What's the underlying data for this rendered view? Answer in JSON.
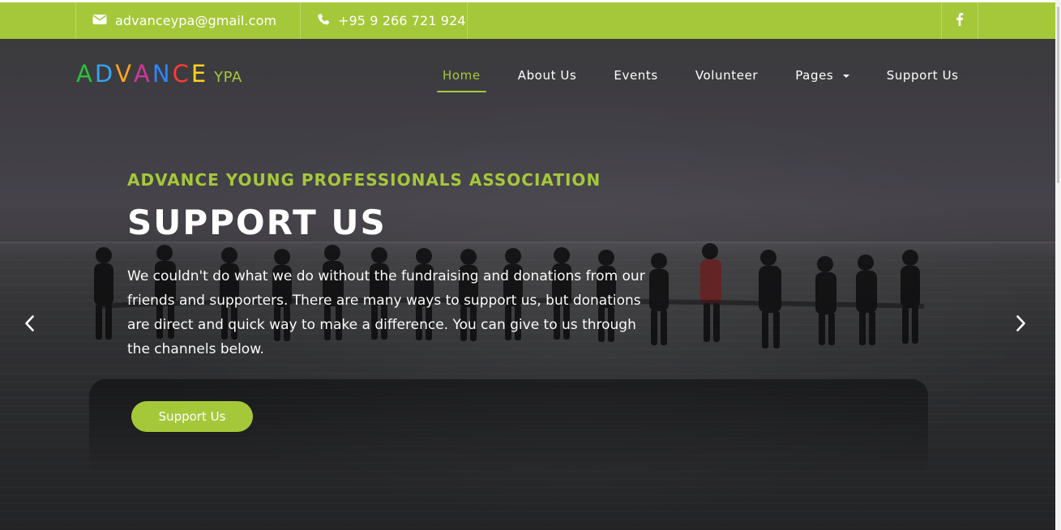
{
  "topbar": {
    "email_icon": "envelope-icon",
    "email": "advanceypa@gmail.com",
    "phone_icon": "phone-icon",
    "phone": "+95 9 266 721 924",
    "social_icon": "facebook-icon"
  },
  "brand": {
    "advance_letters": [
      {
        "char": "A",
        "color": "#2cbf3c"
      },
      {
        "char": "D",
        "color": "#35a4f0"
      },
      {
        "char": "V",
        "color": "#f7a51d"
      },
      {
        "char": "A",
        "color": "#d0389a"
      },
      {
        "char": "N",
        "color": "#2f86ff"
      },
      {
        "char": "C",
        "color": "#ff3b34"
      },
      {
        "char": "E",
        "color": "#ffd21a"
      }
    ],
    "suffix": "YPA"
  },
  "nav": {
    "items": [
      {
        "label": "Home",
        "active": true
      },
      {
        "label": "About Us",
        "active": false
      },
      {
        "label": "Events",
        "active": false
      },
      {
        "label": "Volunteer",
        "active": false
      },
      {
        "label": "Pages",
        "active": false,
        "has_caret": true
      },
      {
        "label": "Support Us",
        "active": false
      }
    ]
  },
  "hero": {
    "eyebrow": "ADVANCE YOUNG PROFESSIONALS ASSOCIATION",
    "title": "SUPPORT US",
    "description": "We couldn't do what we do without the fundraising and donations from our friends and supporters. There are many ways to support us, but donations are direct and quick way to make a difference. You can give to us through the channels below.",
    "cta_label": "Support Us",
    "prev_icon": "chevron-left-icon",
    "next_icon": "chevron-right-icon"
  },
  "colors": {
    "accent": "#a5c83a"
  }
}
